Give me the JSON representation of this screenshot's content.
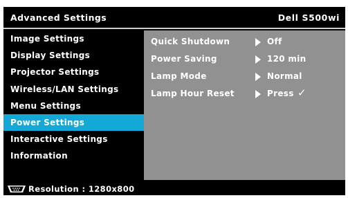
{
  "header": {
    "title": "Advanced Settings",
    "model": "Dell S500wi"
  },
  "menu": {
    "items": [
      {
        "label": "Image Settings"
      },
      {
        "label": "Display Settings"
      },
      {
        "label": "Projector Settings"
      },
      {
        "label": "Wireless/LAN Settings"
      },
      {
        "label": "Menu Settings"
      },
      {
        "label": "Power Settings",
        "selected": true
      },
      {
        "label": "Interactive Settings"
      },
      {
        "label": "Information"
      }
    ]
  },
  "panel": {
    "rows": [
      {
        "label": "Quick Shutdown",
        "value": "Off"
      },
      {
        "label": "Power Saving",
        "value": "120 min"
      },
      {
        "label": "Lamp Mode",
        "value": "Normal"
      },
      {
        "label": "Lamp Hour Reset",
        "value": "Press",
        "check": "✓"
      }
    ]
  },
  "status": {
    "icon": "vga-connector-icon",
    "text": "Resolution : 1280x800"
  },
  "colors": {
    "selected": "#14a8d6",
    "panel": "#919191",
    "background": "#000000"
  }
}
